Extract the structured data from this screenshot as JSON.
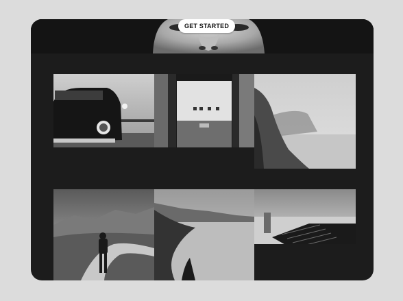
{
  "hero": {
    "cta_label": "GET STARTED",
    "image": "portrait-face-photo"
  },
  "gallery": {
    "rows": [
      {
        "photos": [
          "vintage-car-photo",
          "gallery-room-photo",
          "coastal-cliff-photo"
        ]
      },
      {
        "photos": [
          "man-on-road-photo",
          "lake-mountains-photo",
          "concrete-steps-photo"
        ]
      }
    ]
  },
  "colors": {
    "page_bg": "#dcdcdc",
    "device_bg": "#1c1c1c",
    "cta_bg": "#ffffff"
  }
}
